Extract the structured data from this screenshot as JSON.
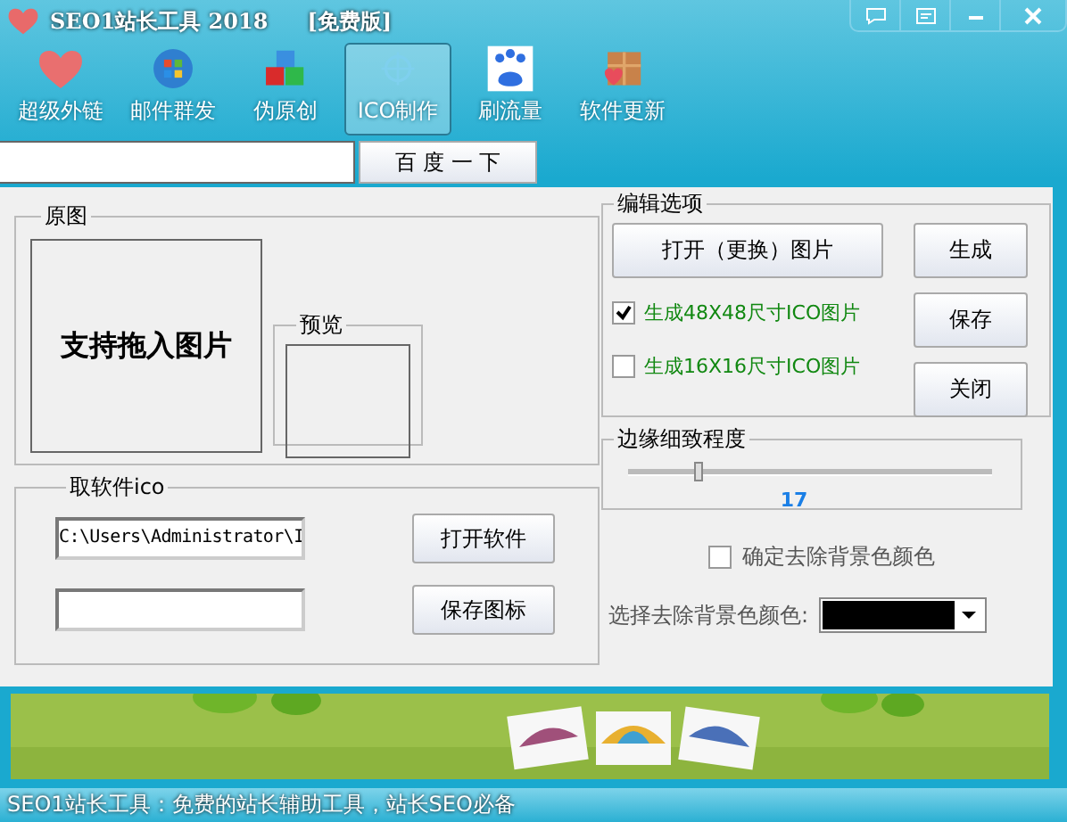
{
  "window": {
    "title": "SEO1站长工具 2018",
    "edition": "[免费版]"
  },
  "toolbar": [
    {
      "label": "超级外链",
      "selected": false
    },
    {
      "label": "邮件群发",
      "selected": false
    },
    {
      "label": "伪原创",
      "selected": false
    },
    {
      "label": "ICO制作",
      "selected": true
    },
    {
      "label": "刷流量",
      "selected": false
    },
    {
      "label": "软件更新",
      "selected": false
    }
  ],
  "search": {
    "button": "百 度 一 下"
  },
  "source_group": {
    "title": "原图",
    "drop_hint": "支持拖入图片",
    "preview_title": "预览"
  },
  "extract_group": {
    "title": "取软件ico",
    "path": "C:\\Users\\Administrator\\I",
    "open_button": "打开软件",
    "save_button": "保存图标"
  },
  "edit_group": {
    "title": "编辑选项",
    "open_image_button": "打开（更换）图片",
    "options": [
      {
        "label": "生成48X48尺寸ICO图片",
        "checked": true
      },
      {
        "label": "生成16X16尺寸ICO图片",
        "checked": false
      }
    ]
  },
  "actions": [
    "生成",
    "保存",
    "关闭"
  ],
  "edge_group": {
    "title": "边缘细致程度",
    "level": 0.19,
    "reading": "17"
  },
  "remove_background": {
    "label": "确定去除背景色颜色",
    "checked": false
  },
  "background_color": {
    "label": "选择去除背景色颜色:",
    "color": "#000000"
  },
  "status_bar": "SEO1站长工具：免费的站长辅助工具，站长SEO必备"
}
